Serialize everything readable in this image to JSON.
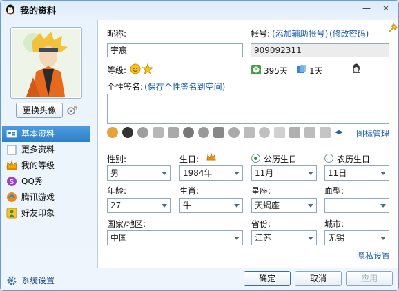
{
  "window": {
    "title": "我的资料",
    "minimize": "—",
    "close": "✕"
  },
  "left": {
    "change_avatar": "更换头像",
    "nav": [
      {
        "label": "基本资料",
        "icon": "person-card-icon"
      },
      {
        "label": "更多资料",
        "icon": "notepad-icon"
      },
      {
        "label": "我的等级",
        "icon": "crown-icon"
      },
      {
        "label": "QQ秀",
        "icon": "qq-show-icon"
      },
      {
        "label": "腾讯游戏",
        "icon": "game-icon"
      },
      {
        "label": "好友印象",
        "icon": "friend-impression-icon"
      }
    ],
    "settings": "系统设置"
  },
  "profile": {
    "nickname_label": "昵称:",
    "nickname": "宇宸",
    "account_label": "帐号:",
    "add_account_link": "(添加辅助帐号)",
    "change_pwd_link": "(修改密码)",
    "account": "909092311",
    "level_label": "等级:",
    "active_days": "395天",
    "login_days": "1天",
    "signature_label": "个性签名:",
    "signature_link": "(保存个性签名到空间)",
    "signature": "",
    "icon_manage": "图标管理"
  },
  "basic": {
    "gender_label": "性别:",
    "gender": "男",
    "birthday_label": "生日:",
    "birth_year": "1984年",
    "solar_label": "公历生日",
    "lunar_label": "农历生日",
    "solar_selected": true,
    "birth_month": "11月",
    "birth_day": "11日",
    "age_label": "年龄:",
    "age": "27",
    "zodiac_label": "生肖:",
    "zodiac": "牛",
    "constellation_label": "星座:",
    "constellation": "天蝎座",
    "blood_label": "血型:",
    "blood": "",
    "country_label": "国家/地区:",
    "country": "中国",
    "province_label": "省份:",
    "province": "江苏",
    "city_label": "城市:",
    "city": "无锡",
    "privacy_link": "隐私设置"
  },
  "buttons": {
    "ok": "确定",
    "cancel": "取消",
    "apply": "应用"
  },
  "colors": {
    "accent": "#2f7fc8",
    "link": "#1b5fae",
    "title_bg": "#dcecfa"
  }
}
